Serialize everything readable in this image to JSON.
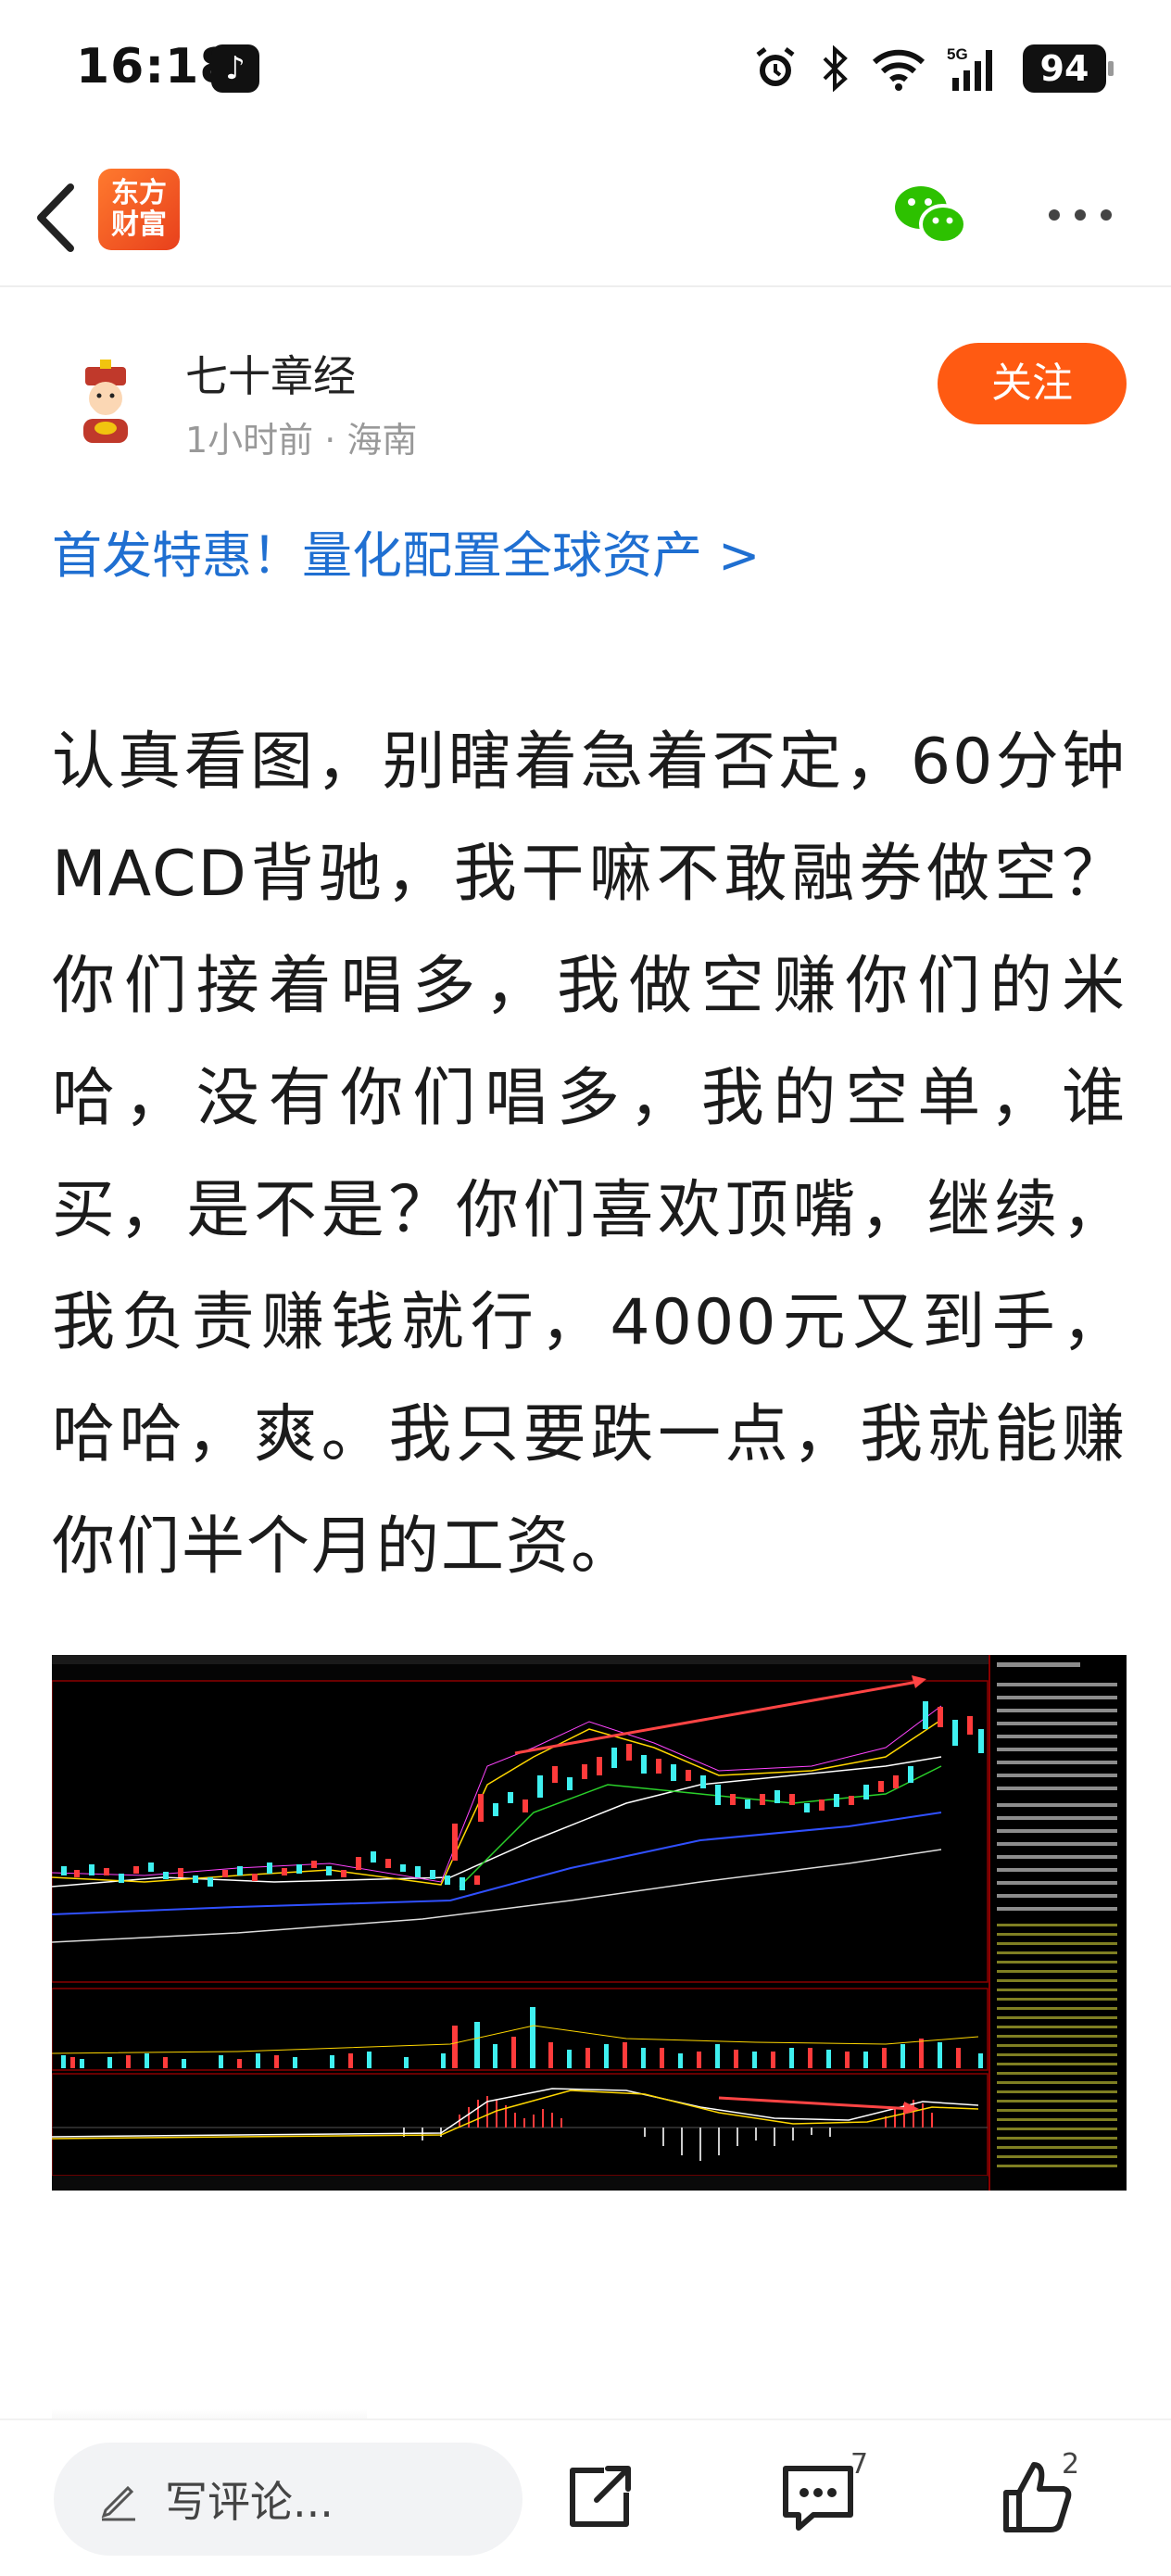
{
  "status_bar": {
    "time": "16:18",
    "battery": "94",
    "network": "5G"
  },
  "nav": {
    "app_logo_text_1": "东方",
    "app_logo_text_2": "财富"
  },
  "author": {
    "name": "七十章经",
    "meta": "1小时前 · 海南",
    "follow_label": "关注"
  },
  "promo": {
    "text": "首发特惠！量化配置全球资产 >"
  },
  "article": {
    "body": "认真看图，别瞎着急着否定，60分钟MACD背驰，我干嘛不敢融券做空？你们接着唱多，我做空赚你们的米哈，没有你们唱多，我的空单，谁买，是不是？你们喜欢顶嘴，继续，我负责赚钱就行，4000元又到手，哈哈，爽。我只要跌一点，我就能赚你们半个月的工资。"
  },
  "bottom_bar": {
    "comment_placeholder": "写评论...",
    "comment_count": "7",
    "like_count": "2"
  },
  "colors": {
    "accent": "#ff5a12",
    "link": "#1f6fd1",
    "chart_bg": "#000000",
    "chart_red": "#ff3b3b",
    "chart_cyan": "#3ff0f0"
  }
}
